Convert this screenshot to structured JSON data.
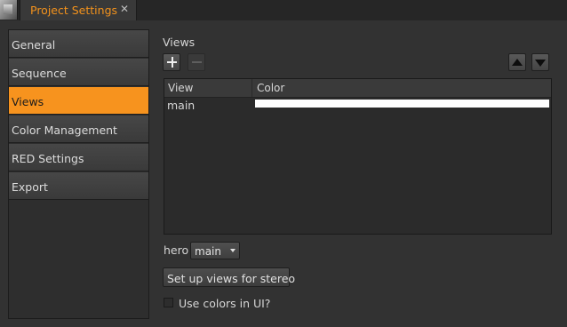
{
  "window": {
    "tab_title": "Project Settings",
    "tab_close_glyph": "✕"
  },
  "sidebar": {
    "items": [
      {
        "label": "General",
        "active": false
      },
      {
        "label": "Sequence",
        "active": false
      },
      {
        "label": "Views",
        "active": true
      },
      {
        "label": "Color Management",
        "active": false
      },
      {
        "label": "RED Settings",
        "active": false
      },
      {
        "label": "Export",
        "active": false
      }
    ]
  },
  "views": {
    "section_title": "Views",
    "toolbar": {
      "add_icon": "plus-icon",
      "remove_icon": "minus-icon",
      "move_up_icon": "arrow-up-icon",
      "move_down_icon": "arrow-down-icon"
    },
    "table": {
      "columns": [
        "View",
        "Color"
      ],
      "rows": [
        {
          "view": "main",
          "color": "#ffffff"
        }
      ]
    },
    "hero": {
      "label": "hero",
      "value": "main"
    },
    "stereo_button_label": "Set up views for stereo",
    "use_colors": {
      "label": "Use colors in UI?",
      "checked": false
    }
  },
  "colors": {
    "accent": "#f7931e",
    "background": "#323232"
  }
}
